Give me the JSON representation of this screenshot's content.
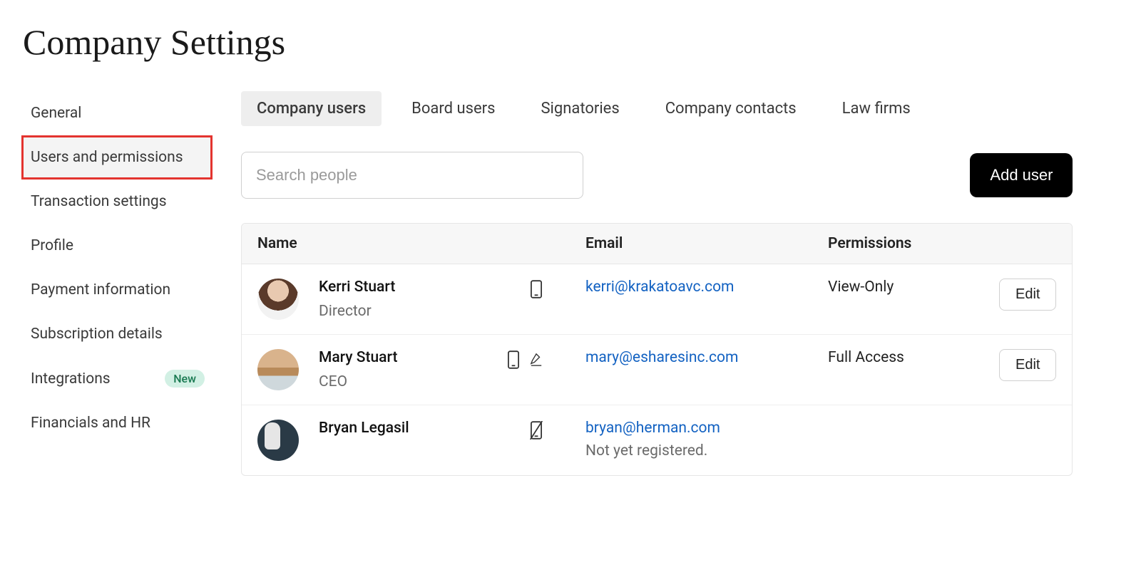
{
  "page_title": "Company Settings",
  "sidebar": {
    "items": [
      {
        "label": "General",
        "active": false
      },
      {
        "label": "Users and permissions",
        "active": true
      },
      {
        "label": "Transaction settings",
        "active": false
      },
      {
        "label": "Profile",
        "active": false
      },
      {
        "label": "Payment information",
        "active": false
      },
      {
        "label": "Subscription details",
        "active": false
      },
      {
        "label": "Integrations",
        "active": false,
        "badge": "New"
      },
      {
        "label": "Financials and HR",
        "active": false
      }
    ]
  },
  "tabs": [
    {
      "label": "Company users",
      "active": true
    },
    {
      "label": "Board users",
      "active": false
    },
    {
      "label": "Signatories",
      "active": false
    },
    {
      "label": "Company contacts",
      "active": false
    },
    {
      "label": "Law firms",
      "active": false
    }
  ],
  "search": {
    "placeholder": "Search people",
    "value": ""
  },
  "add_user_label": "Add user",
  "table": {
    "columns": {
      "name": "Name",
      "email": "Email",
      "permissions": "Permissions"
    },
    "edit_label": "Edit",
    "rows": [
      {
        "name": "Kerri Stuart",
        "role": "Director",
        "email": "kerri@krakatoavc.com",
        "permissions": "View-Only",
        "icons": [
          "phone"
        ],
        "editable": true,
        "registered": true
      },
      {
        "name": "Mary Stuart",
        "role": "CEO",
        "email": "mary@esharesinc.com",
        "permissions": "Full Access",
        "icons": [
          "phone",
          "signature"
        ],
        "editable": true,
        "registered": true
      },
      {
        "name": "Bryan Legasil",
        "role": "",
        "email": "bryan@herman.com",
        "permissions": "",
        "icons": [
          "phone-off"
        ],
        "editable": false,
        "registered": false,
        "not_registered_text": "Not yet registered."
      }
    ]
  }
}
